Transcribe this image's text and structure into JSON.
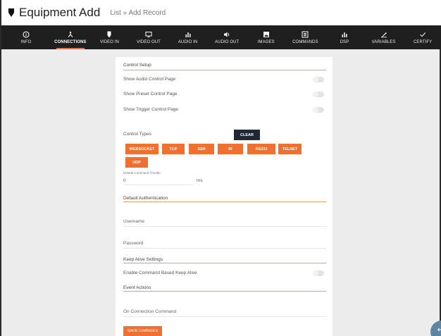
{
  "header": {
    "title": "Equipment Add",
    "breadcrumb": "List » Add Record"
  },
  "tabs": [
    {
      "label": "INFO",
      "icon": "info-icon"
    },
    {
      "label": "CONNECTIONS",
      "icon": "connections-icon",
      "active": true
    },
    {
      "label": "VIDEO IN",
      "icon": "video-in-icon"
    },
    {
      "label": "VIDEO OUT",
      "icon": "video-out-icon"
    },
    {
      "label": "AUDIO IN",
      "icon": "audio-in-icon"
    },
    {
      "label": "AUDIO OUT",
      "icon": "audio-out-icon"
    },
    {
      "label": "IMAGES",
      "icon": "images-icon"
    },
    {
      "label": "COMMANDS",
      "icon": "commands-icon"
    },
    {
      "label": "DSP",
      "icon": "dsp-icon"
    },
    {
      "label": "VARIABLES",
      "icon": "variables-icon"
    },
    {
      "label": "CERTIFY",
      "icon": "checkmark-icon"
    }
  ],
  "control_setup": {
    "title": "Control Setup",
    "show_audio": "Show Audio Control Page",
    "show_preset": "Show Preset Control Page",
    "show_trigger": "Show Trigger Control Page"
  },
  "control_types": {
    "label": "Control Types",
    "clear_label": "CLEAR",
    "types": [
      "WEBSOCKET",
      "TCP",
      "SSH",
      "IR",
      "RS232",
      "TELNET",
      "UDP"
    ]
  },
  "throttle": {
    "label": "Default Command Throttle",
    "value": "0",
    "unit": "ms"
  },
  "auth": {
    "title": "Default Authentication",
    "username_placeholder": "Username",
    "password_placeholder": "Password"
  },
  "keep_alive": {
    "title": "Keep Alive Settings",
    "enable_label": "Enable Command Based Keep Alive"
  },
  "event_actions": {
    "title": "Event Actions",
    "on_connection_placeholder": "On Connection Command"
  },
  "save_label": "SAVE CHANGES",
  "colors": {
    "accent": "#f07031",
    "tabbar": "#1f1f1f",
    "clear_button": "#202933",
    "fab": "#5e86a0"
  }
}
